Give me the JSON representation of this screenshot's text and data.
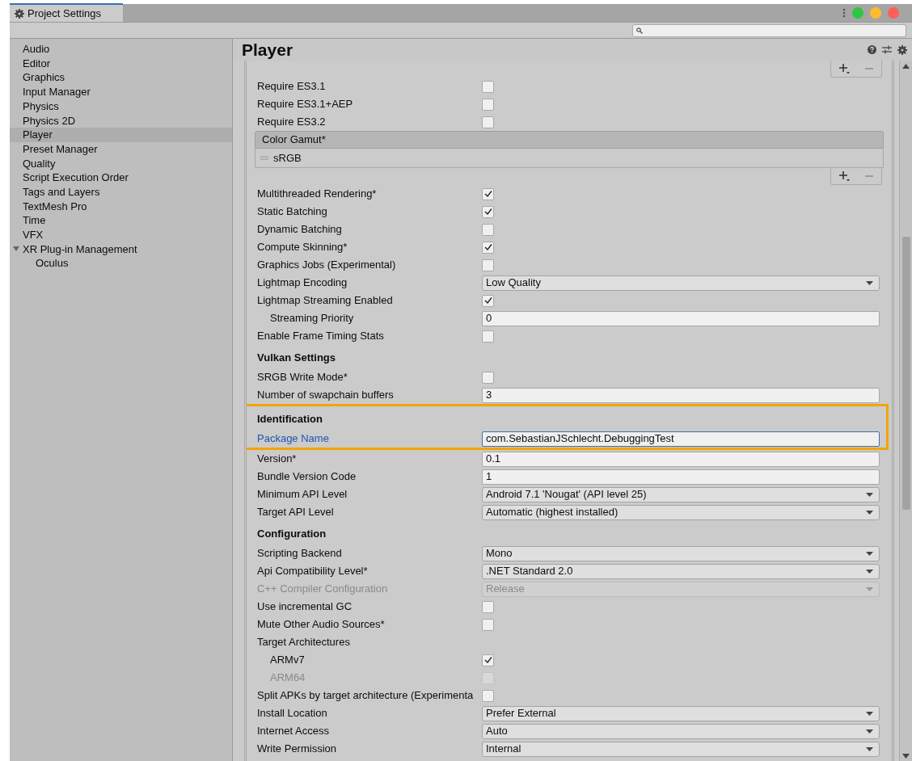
{
  "window": {
    "tab_title": "Project Settings"
  },
  "sidebar": {
    "items": [
      {
        "label": "Audio",
        "selected": false
      },
      {
        "label": "Editor",
        "selected": false
      },
      {
        "label": "Graphics",
        "selected": false
      },
      {
        "label": "Input Manager",
        "selected": false
      },
      {
        "label": "Physics",
        "selected": false
      },
      {
        "label": "Physics 2D",
        "selected": false
      },
      {
        "label": "Player",
        "selected": true
      },
      {
        "label": "Preset Manager",
        "selected": false
      },
      {
        "label": "Quality",
        "selected": false
      },
      {
        "label": "Script Execution Order",
        "selected": false
      },
      {
        "label": "Tags and Layers",
        "selected": false
      },
      {
        "label": "TextMesh Pro",
        "selected": false
      },
      {
        "label": "Time",
        "selected": false
      },
      {
        "label": "VFX",
        "selected": false
      },
      {
        "label": "XR Plug-in Management",
        "selected": false,
        "expanded": true,
        "children": [
          {
            "label": "Oculus",
            "selected": false
          }
        ]
      }
    ]
  },
  "panel": {
    "title": "Player",
    "rows": [
      {
        "kind": "list_footer"
      },
      {
        "kind": "checkbox",
        "label": "Require ES3.1",
        "checked": false
      },
      {
        "kind": "checkbox",
        "label": "Require ES3.1+AEP",
        "checked": false
      },
      {
        "kind": "checkbox",
        "label": "Require ES3.2",
        "checked": false
      },
      {
        "kind": "list",
        "title": "Color Gamut*",
        "items": [
          "sRGB"
        ]
      },
      {
        "kind": "list_footer"
      },
      {
        "kind": "checkbox",
        "label": "Multithreaded Rendering*",
        "checked": true
      },
      {
        "kind": "checkbox",
        "label": "Static Batching",
        "checked": true
      },
      {
        "kind": "checkbox",
        "label": "Dynamic Batching",
        "checked": false
      },
      {
        "kind": "checkbox",
        "label": "Compute Skinning*",
        "checked": true
      },
      {
        "kind": "checkbox",
        "label": "Graphics Jobs (Experimental)",
        "checked": false
      },
      {
        "kind": "dropdown",
        "label": "Lightmap Encoding",
        "value": "Low Quality"
      },
      {
        "kind": "checkbox",
        "label": "Lightmap Streaming Enabled",
        "checked": true
      },
      {
        "kind": "field",
        "label": "Streaming Priority",
        "value": "0",
        "indented": true
      },
      {
        "kind": "checkbox",
        "label": "Enable Frame Timing Stats",
        "checked": false
      },
      {
        "kind": "header",
        "label": "Vulkan Settings"
      },
      {
        "kind": "checkbox",
        "label": "SRGB Write Mode*",
        "checked": false
      },
      {
        "kind": "field",
        "label": "Number of swapchain buffers",
        "value": "3"
      },
      {
        "kind": "highlight",
        "rows": [
          {
            "kind": "header",
            "label": "Identification"
          },
          {
            "kind": "field",
            "label": "Package Name",
            "value": "com.SebastianJSchlecht.DebuggingTest",
            "focused": true
          }
        ]
      },
      {
        "kind": "field",
        "label": "Version*",
        "value": "0.1"
      },
      {
        "kind": "field",
        "label": "Bundle Version Code",
        "value": "1"
      },
      {
        "kind": "dropdown",
        "label": "Minimum API Level",
        "value": "Android 7.1 'Nougat' (API level 25)"
      },
      {
        "kind": "dropdown",
        "label": "Target API Level",
        "value": "Automatic (highest installed)"
      },
      {
        "kind": "header",
        "label": "Configuration"
      },
      {
        "kind": "dropdown",
        "label": "Scripting Backend",
        "value": "Mono"
      },
      {
        "kind": "dropdown",
        "label": "Api Compatibility Level*",
        "value": ".NET Standard 2.0"
      },
      {
        "kind": "dropdown",
        "label": "C++ Compiler Configuration",
        "value": "Release",
        "disabled": true
      },
      {
        "kind": "checkbox",
        "label": "Use incremental GC",
        "checked": false
      },
      {
        "kind": "checkbox",
        "label": "Mute Other Audio Sources*",
        "checked": false
      },
      {
        "kind": "label",
        "label": "Target Architectures"
      },
      {
        "kind": "checkbox",
        "label": "ARMv7",
        "checked": true,
        "indented": true
      },
      {
        "kind": "checkbox",
        "label": "ARM64",
        "checked": false,
        "indented": true,
        "disabled": true
      },
      {
        "kind": "checkbox",
        "label": "Split APKs by target architecture (Experimenta",
        "checked": false
      },
      {
        "kind": "dropdown",
        "label": "Install Location",
        "value": "Prefer External"
      },
      {
        "kind": "dropdown",
        "label": "Internet Access",
        "value": "Auto"
      },
      {
        "kind": "dropdown",
        "label": "Write Permission",
        "value": "Internal"
      }
    ]
  }
}
